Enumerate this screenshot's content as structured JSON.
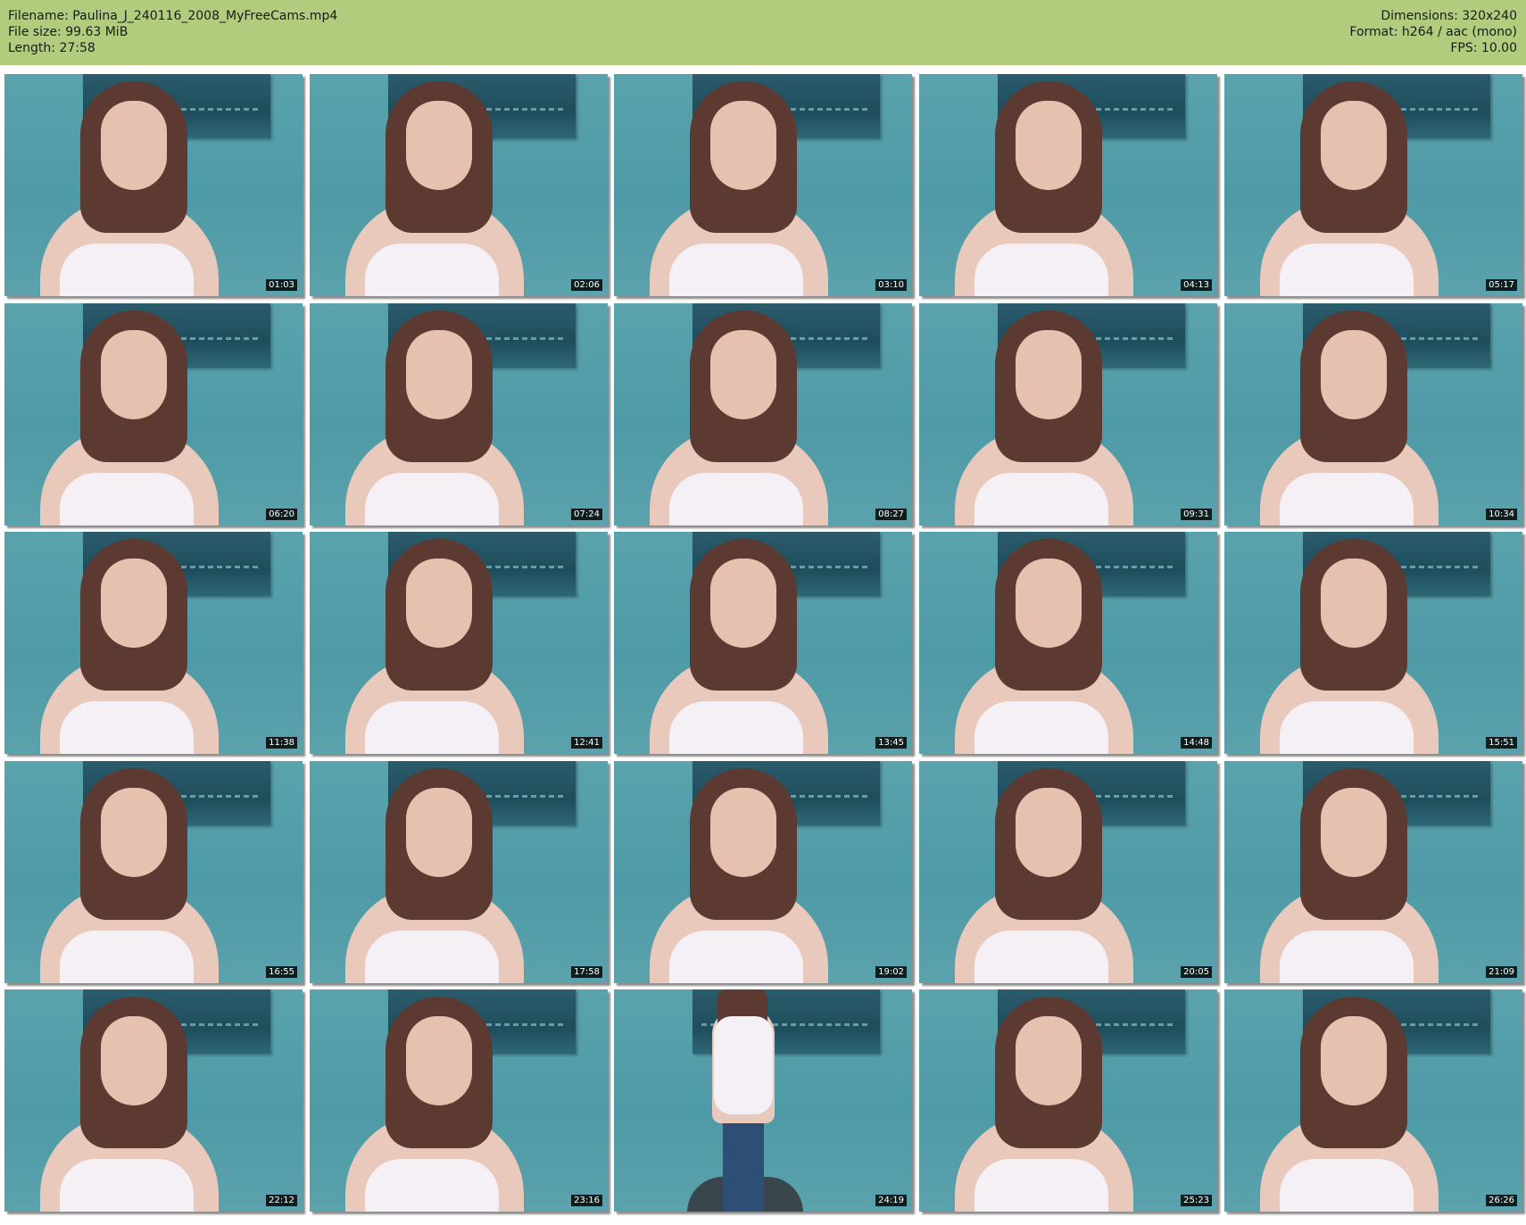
{
  "header": {
    "left_lines": [
      "Filename: Paulina_J_240116_2008_MyFreeCams.mp4",
      "File size: 99.63 MiB",
      "Length: 27:58"
    ],
    "right_lines": [
      "Dimensions: 320x240",
      "Format: h264 / aac (mono)",
      "FPS: 10.00"
    ],
    "background_color": "#b2cc7e"
  },
  "thumbnails": [
    {
      "timestamp": "01:03"
    },
    {
      "timestamp": "02:06"
    },
    {
      "timestamp": "03:10"
    },
    {
      "timestamp": "04:13"
    },
    {
      "timestamp": "05:17"
    },
    {
      "timestamp": "06:20"
    },
    {
      "timestamp": "07:24"
    },
    {
      "timestamp": "08:27"
    },
    {
      "timestamp": "09:31"
    },
    {
      "timestamp": "10:34"
    },
    {
      "timestamp": "11:38"
    },
    {
      "timestamp": "12:41"
    },
    {
      "timestamp": "13:45"
    },
    {
      "timestamp": "14:48"
    },
    {
      "timestamp": "15:51"
    },
    {
      "timestamp": "16:55"
    },
    {
      "timestamp": "17:58"
    },
    {
      "timestamp": "19:02"
    },
    {
      "timestamp": "20:05"
    },
    {
      "timestamp": "21:09"
    },
    {
      "timestamp": "22:12"
    },
    {
      "timestamp": "23:16"
    },
    {
      "timestamp": "24:19",
      "scene": "standing"
    },
    {
      "timestamp": "25:23"
    },
    {
      "timestamp": "26:26"
    }
  ]
}
